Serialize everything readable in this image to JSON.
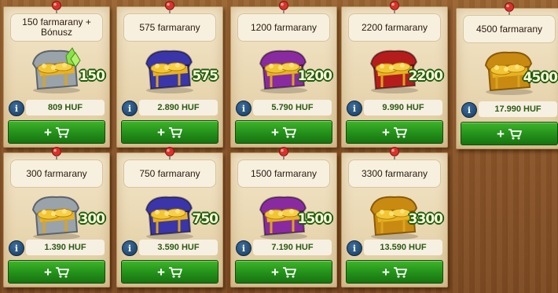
{
  "currency_label": "farmarany",
  "cards": [
    {
      "title": "150 farmarany + Bónusz",
      "amount": "150",
      "price": "809 HUF",
      "chest": "silver",
      "bonus": true
    },
    {
      "title": "575 farmarany",
      "amount": "575",
      "price": "2.890 HUF",
      "chest": "blue",
      "bonus": false
    },
    {
      "title": "1200 farmarany",
      "amount": "1200",
      "price": "5.790 HUF",
      "chest": "purple",
      "bonus": false
    },
    {
      "title": "2200 farmarany",
      "amount": "2200",
      "price": "9.990 HUF",
      "chest": "red",
      "bonus": false
    },
    {
      "title": "4500 farmarany",
      "amount": "4500",
      "price": "17.990 HUF",
      "chest": "gold",
      "bonus": false
    },
    {
      "title": "300 farmarany",
      "amount": "300",
      "price": "1.390 HUF",
      "chest": "silver",
      "bonus": false
    },
    {
      "title": "750 farmarany",
      "amount": "750",
      "price": "3.590 HUF",
      "chest": "blue",
      "bonus": false
    },
    {
      "title": "1500 farmarany",
      "amount": "1500",
      "price": "7.190 HUF",
      "chest": "purple",
      "bonus": false
    },
    {
      "title": "3300 farmarany",
      "amount": "3300",
      "price": "13.590 HUF",
      "chest": "gold",
      "bonus": false
    }
  ],
  "info_label": "i",
  "buy_label": "+",
  "icons": {
    "info": "info-icon",
    "cart": "shopping-cart-icon",
    "pin": "pushpin-icon",
    "chest": "treasure-chest-icon"
  },
  "colors": {
    "button_green": "#23901a",
    "price_green": "#2d5a12",
    "silver": "#9aa3aa",
    "blue": "#3a35a8",
    "purple": "#8a2aa0",
    "red": "#b51d1d",
    "gold": "#c98a12"
  }
}
